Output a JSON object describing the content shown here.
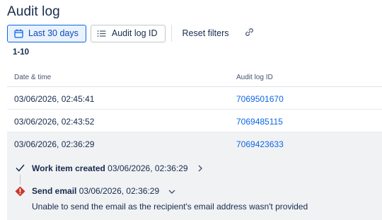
{
  "header": {
    "title": "Audit log"
  },
  "toolbar": {
    "date_filter": "Last 30 days",
    "id_filter": "Audit log ID",
    "reset": "Reset filters"
  },
  "results": {
    "range": "1-10"
  },
  "table": {
    "columns": [
      "Date & time",
      "Audit log ID"
    ],
    "rows": [
      {
        "date": "03/06/2026, 02:45:41",
        "id": "7069501670"
      },
      {
        "date": "03/06/2026, 02:43:52",
        "id": "7069485115"
      },
      {
        "date": "03/06/2026, 02:36:29",
        "id": "7069423633"
      }
    ]
  },
  "expanded_details": {
    "step1": {
      "title": "Work item created",
      "time": "03/06/2026, 02:36:29"
    },
    "step2": {
      "title": "Send email",
      "time": "03/06/2026, 02:36:29",
      "message": "Unable to send the email as the recipient's email address wasn't provided"
    }
  },
  "colors": {
    "accent": "#0c66e4",
    "error": "#c9372c",
    "expanded_bg": "#f1f2f4"
  }
}
